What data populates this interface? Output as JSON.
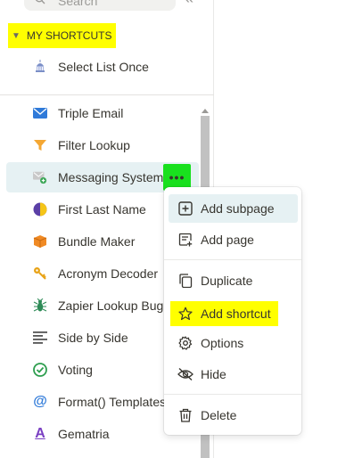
{
  "search": {
    "placeholder": "Search"
  },
  "sidebar": {
    "section_label": "MY SHORTCUTS",
    "shortcuts": [
      {
        "label": "Select List Once",
        "icon": "capitol-building-icon"
      }
    ],
    "pages": [
      {
        "label": "Triple Email",
        "icon": "envelope-icon"
      },
      {
        "label": "Filter Lookup",
        "icon": "funnel-icon"
      },
      {
        "label": "Messaging System",
        "icon": "envelope-plus-icon"
      },
      {
        "label": "First Last Name",
        "icon": "half-moon-icon"
      },
      {
        "label": "Bundle Maker",
        "icon": "box-icon"
      },
      {
        "label": "Acronym Decoder",
        "icon": "key-icon"
      },
      {
        "label": "Zapier Lookup Bug",
        "icon": "bug-icon"
      },
      {
        "label": "Side by Side",
        "icon": "lines-icon"
      },
      {
        "label": "Voting",
        "icon": "check-circle-icon"
      },
      {
        "label": "Format() Templates",
        "icon": "at-sign-icon"
      },
      {
        "label": "Gematria",
        "icon": "letter-a-icon"
      }
    ]
  },
  "context_menu": {
    "items": [
      {
        "label": "Add subpage",
        "icon": "plus-square-icon"
      },
      {
        "label": "Add page",
        "icon": "add-page-icon"
      },
      {
        "label": "Duplicate",
        "icon": "copy-icon"
      },
      {
        "label": "Add shortcut",
        "icon": "star-icon"
      },
      {
        "label": "Options",
        "icon": "gear-icon"
      },
      {
        "label": "Hide",
        "icon": "eye-off-icon"
      },
      {
        "label": "Delete",
        "icon": "trash-icon"
      }
    ]
  },
  "colors": {
    "highlight": "#ffff00",
    "more_button": "#19e01e",
    "hover": "#e6f1f3"
  }
}
